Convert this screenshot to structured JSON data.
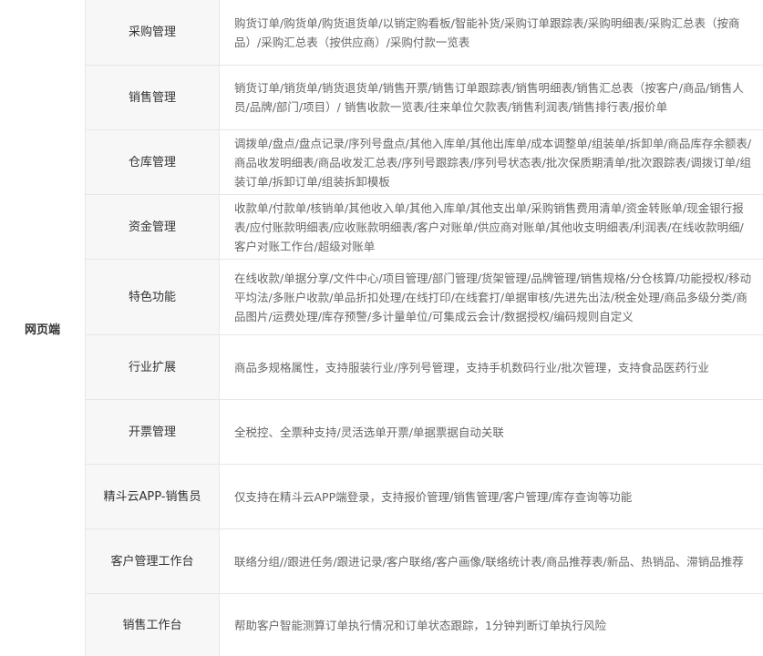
{
  "category": "网页端",
  "rows": [
    {
      "name": "采购管理",
      "desc": "购货订单/购货单/购货退货单/以销定购看板/智能补货/采购订单跟踪表/采购明细表/采购汇总表（按商品）/采购汇总表（按供应商）/采购付款一览表"
    },
    {
      "name": "销售管理",
      "desc": "销货订单/销货单/销货退货单/销售开票/销售订单跟踪表/销售明细表/销售汇总表（按客户/商品/销售人员/品牌/部门/项目）/ 销售收款一览表/往来单位欠款表/销售利润表/销售排行表/报价单"
    },
    {
      "name": "仓库管理",
      "desc": "调拨单/盘点/盘点记录/序列号盘点/其他入库单/其他出库单/成本调整单/组装单/拆卸单/商品库存余额表/商品收发明细表/商品收发汇总表/序列号跟踪表/序列号状态表/批次保质期清单/批次跟踪表/调拨订单/组装订单/拆卸订单/组装拆卸模板"
    },
    {
      "name": "资金管理",
      "desc": "收款单/付款单/核销单/其他收入单/其他入库单/其他支出单/采购销售费用清单/资金转账单/现金银行报表/应付账款明细表/应收账款明细表/客户对账单/供应商对账单/其他收支明细表/利润表/在线收款明细/客户对账工作台/超级对账单"
    },
    {
      "name": "特色功能",
      "desc": "在线收款/单据分享/文件中心/项目管理/部门管理/货架管理/品牌管理/销售规格/分仓核算/功能授权/移动平均法/多账户收款/单品折扣处理/在线打印/在线套打/单据审核/先进先出法/税金处理/商品多级分类/商品图片/运费处理/库存预警/多计量单位/可集成云会计/数据授权/编码规则自定义"
    },
    {
      "name": "行业扩展",
      "desc": "商品多规格属性，支持服装行业/序列号管理，支持手机数码行业/批次管理，支持食品医药行业"
    },
    {
      "name": "开票管理",
      "desc": "全税控、全票种支持/灵活选单开票/单据票据自动关联"
    },
    {
      "name": "精斗云APP-销售员",
      "desc": "仅支持在精斗云APP端登录，支持报价管理/销售管理/客户管理/库存查询等功能"
    },
    {
      "name": "客户管理工作台",
      "desc": "联络分组//跟进任务/跟进记录/客户联络/客户画像/联络统计表/商品推荐表/新品、热销品、滞销品推荐"
    },
    {
      "name": "销售工作台",
      "desc": "帮助客户智能测算订单执行情况和订单状态跟踪，1分钟判断订单执行风险"
    }
  ]
}
